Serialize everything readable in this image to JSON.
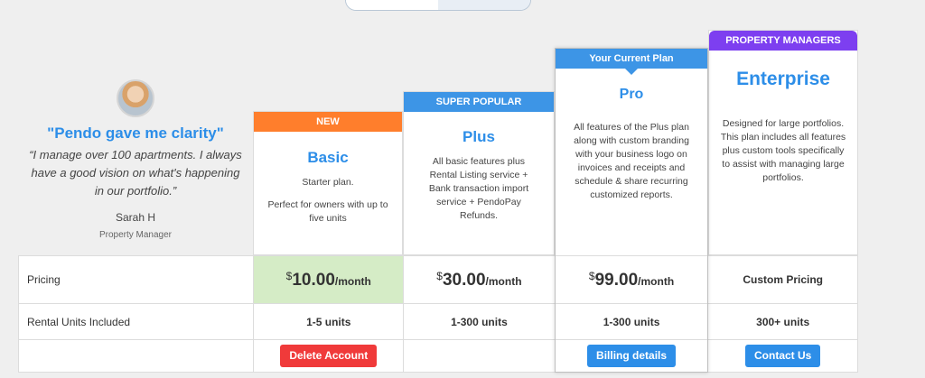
{
  "testimonial": {
    "title": "\"Pendo gave me clarity\"",
    "quote": "“I manage over 100 apartments. I always have a good vision on what's happening in our portfolio.”",
    "author": "Sarah H",
    "role": "Property Manager"
  },
  "plans": [
    {
      "badge": "NEW",
      "name": "Basic",
      "desc1": "Starter plan.",
      "desc2": "Perfect for owners with up to five units",
      "price": "10.00",
      "units": "1-5 units",
      "action": "Delete Account"
    },
    {
      "badge": "SUPER POPULAR",
      "name": "Plus",
      "desc1": "All basic features plus Rental Listing service + Bank transaction import service + PendoPay Refunds.",
      "price": "30.00",
      "units": "1-300 units"
    },
    {
      "badge": "Your Current Plan",
      "name": "Pro",
      "desc1": "All features of the Plus plan along with custom branding with your business logo on invoices and receipts and schedule & share recurring customized reports.",
      "price": "99.00",
      "units": "1-300 units",
      "action": "Billing details"
    },
    {
      "badge": "PROPERTY MANAGERS",
      "name": "Enterprise",
      "desc1": "Designed for large portfolios. This plan includes all features plus custom tools specifically to assist with managing large portfolios.",
      "price_text": "Custom Pricing",
      "units": "300+ units",
      "action": "Contact Us"
    }
  ],
  "table": {
    "pricing_label": "Pricing",
    "units_label": "Rental Units Included",
    "currency": "$",
    "per": "/month"
  },
  "colors": {
    "accent_blue": "#2d8ee8",
    "badge_orange": "#ff7e2c",
    "badge_purple": "#7d3ff0",
    "danger_red": "#f03a3a",
    "current_plan_highlight": "#d5ecc6"
  }
}
